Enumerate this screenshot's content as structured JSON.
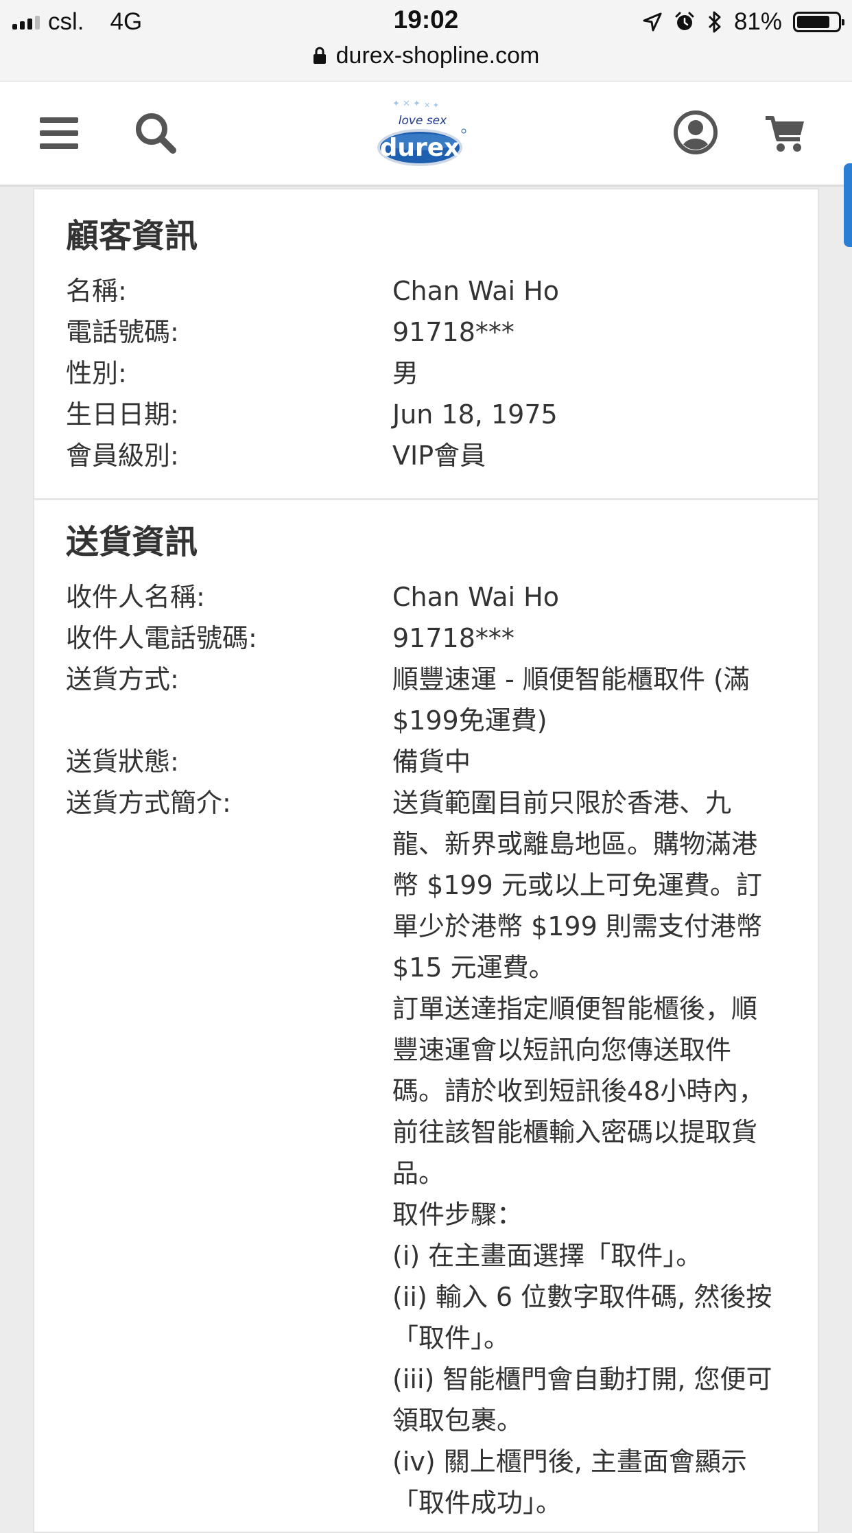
{
  "status_bar": {
    "carrier": "csl.",
    "network": "4G",
    "time": "19:02",
    "battery": "81%",
    "battery_level": 0.81,
    "url": "durex-shopline.com"
  },
  "header": {
    "logo_tagline": "love sex",
    "logo_brand": "durex",
    "icons": [
      "menu-icon",
      "search-icon",
      "account-icon",
      "cart-icon"
    ]
  },
  "customer": {
    "title": "顧客資訊",
    "rows": [
      {
        "label": "名稱:",
        "value": "Chan Wai Ho"
      },
      {
        "label": "電話號碼:",
        "value": "91718***"
      },
      {
        "label": "性別:",
        "value": "男"
      },
      {
        "label": "生日日期:",
        "value": "Jun 18, 1975"
      },
      {
        "label": "會員級別:",
        "value": "VIP會員"
      }
    ]
  },
  "delivery": {
    "title": "送貨資訊",
    "recipient_name_label": "收件人名稱:",
    "recipient_name": "Chan Wai Ho",
    "recipient_phone_label": "收件人電話號碼:",
    "recipient_phone": "91718***",
    "method_label": "送貨方式:",
    "method": "順豐速運 - 順便智能櫃取件 (滿$199免運費)",
    "status_label": "送貨狀態:",
    "status": "備貨中",
    "desc_label": "送貨方式簡介:",
    "desc_paragraphs": [
      "送貨範圍目前只限於香港、九龍、新界或離島地區。購物滿港幣 $199 元或以上可免運費。訂單少於港幣 $199 則需支付港幣 $15 元運費。",
      "訂單送達指定順便智能櫃後，順豐速運會以短訊向您傳送取件碼。請於收到短訊後48小時內，前往該智能櫃輸入密碼以提取貨品。",
      "取件步驟：",
      "(i) 在主畫面選擇「取件」。",
      "(ii) 輸入 6 位數字取件碼, 然後按「取件」。",
      "(iii) 智能櫃門會自動打開, 您便可領取包裹。",
      "(iv) 關上櫃門後, 主畫面會顯示「取件成功」。"
    ]
  }
}
